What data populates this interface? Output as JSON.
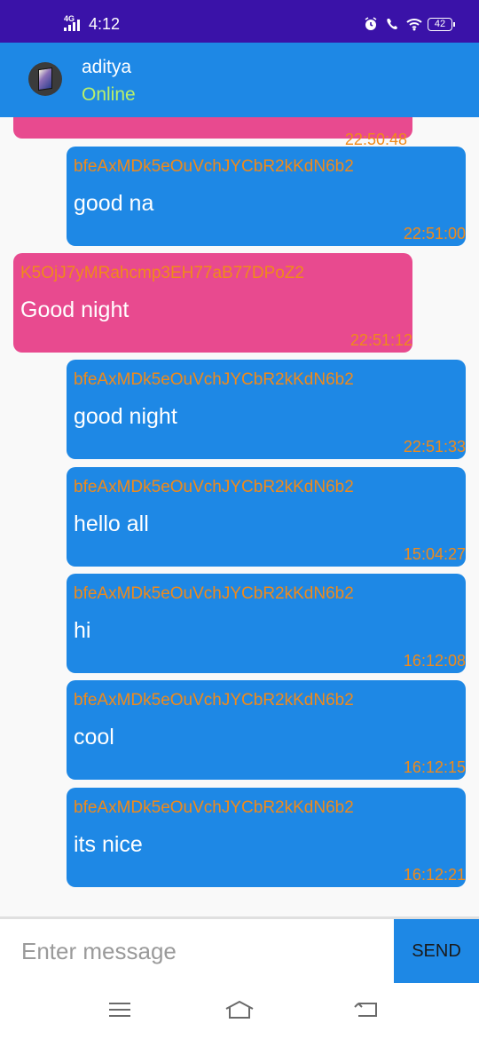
{
  "status_bar": {
    "network": "4G",
    "time": "4:12",
    "battery": "42",
    "icons": [
      "network-signal-icon",
      "alarm-icon",
      "call-icon",
      "wifi-icon",
      "battery-icon"
    ]
  },
  "header": {
    "contact_name": "aditya",
    "contact_status": "Online",
    "colors": {
      "background": "#1e88e5",
      "status": "#b9f06a"
    }
  },
  "messages": [
    {
      "type": "recv",
      "sender": "",
      "text": "",
      "time": "22:50:48"
    },
    {
      "type": "sent",
      "sender": "bfeAxMDk5eOuVchJYCbR2kKdN6b2",
      "text": "good na",
      "time": "22:51:00"
    },
    {
      "type": "recv",
      "sender": "K5OjJ7yMRahcmp3EH77aB77DPoZ2",
      "text": "Good  night",
      "time": "22:51:12"
    },
    {
      "type": "sent",
      "sender": "bfeAxMDk5eOuVchJYCbR2kKdN6b2",
      "text": "good night",
      "time": "22:51:33"
    },
    {
      "type": "sent",
      "sender": "bfeAxMDk5eOuVchJYCbR2kKdN6b2",
      "text": "hello all",
      "time": "15:04:27"
    },
    {
      "type": "sent",
      "sender": "bfeAxMDk5eOuVchJYCbR2kKdN6b2",
      "text": "hi",
      "time": "16:12:08"
    },
    {
      "type": "sent",
      "sender": "bfeAxMDk5eOuVchJYCbR2kKdN6b2",
      "text": "cool",
      "time": "16:12:15"
    },
    {
      "type": "sent",
      "sender": "bfeAxMDk5eOuVchJYCbR2kKdN6b2",
      "text": "its nice",
      "time": "16:12:21"
    }
  ],
  "colors": {
    "sent_bubble": "#1e88e5",
    "recv_bubble": "#e84a8f",
    "meta_text": "#f08a1a"
  },
  "composer": {
    "placeholder": "Enter message",
    "send_label": "SEND"
  },
  "nav": {
    "icons": [
      "menu-icon",
      "home-icon",
      "back-icon"
    ]
  }
}
